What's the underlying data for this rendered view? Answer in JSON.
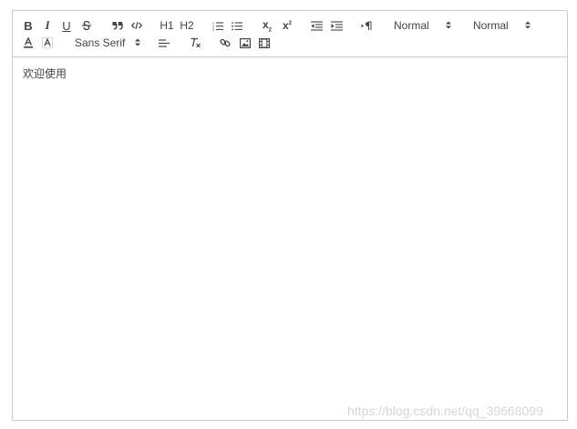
{
  "toolbar": {
    "row1": {
      "bold": "B",
      "italic": "I",
      "underline": "U",
      "h1": "H1",
      "h2": "H2",
      "sub": "x",
      "sup": "x"
    },
    "pickers": {
      "size": "Normal",
      "header": "Normal",
      "font": "Sans Serif"
    }
  },
  "editor": {
    "content": "欢迎使用"
  },
  "watermark": "https://blog.csdn.net/qq_39668099",
  "colors": {
    "border": "#cccccc",
    "icon": "#444444",
    "text": "#444444",
    "watermark": "#d6d6d6"
  }
}
